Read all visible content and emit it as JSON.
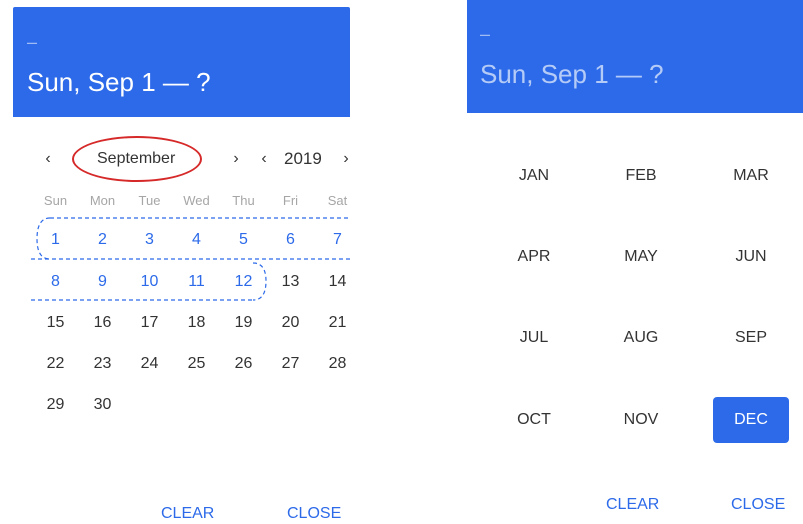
{
  "left": {
    "header": {
      "dash": "–",
      "title": "Sun, Sep 1 — ?"
    },
    "nav": {
      "prev_month": "‹",
      "month": "September",
      "next_month": "›",
      "prev_year": "‹",
      "year": "2019",
      "next_year": "›"
    },
    "weekdays": [
      "Sun",
      "Mon",
      "Tue",
      "Wed",
      "Thu",
      "Fri",
      "Sat"
    ],
    "weeks": [
      [
        "1",
        "2",
        "3",
        "4",
        "5",
        "6",
        "7"
      ],
      [
        "8",
        "9",
        "10",
        "11",
        "12",
        "13",
        "14"
      ],
      [
        "15",
        "16",
        "17",
        "18",
        "19",
        "20",
        "21"
      ],
      [
        "22",
        "23",
        "24",
        "25",
        "26",
        "27",
        "28"
      ],
      [
        "29",
        "30",
        "",
        "",
        "",
        "",
        ""
      ]
    ],
    "highlighted_days": [
      "1",
      "2",
      "3",
      "4",
      "5",
      "6",
      "7",
      "8",
      "9",
      "10",
      "11",
      "12"
    ],
    "buttons": {
      "clear": "CLEAR",
      "close": "CLOSE"
    }
  },
  "right": {
    "header": {
      "dash": "–",
      "title": "Sun, Sep 1 — ?"
    },
    "months": [
      [
        "JAN",
        "FEB",
        "MAR"
      ],
      [
        "APR",
        "MAY",
        "JUN"
      ],
      [
        "JUL",
        "AUG",
        "SEP"
      ],
      [
        "OCT",
        "NOV",
        "DEC"
      ]
    ],
    "selected_month": "DEC",
    "buttons": {
      "clear": "CLEAR",
      "close": "CLOSE"
    }
  },
  "colors": {
    "accent": "#2c6ae9",
    "annotation": "#d62929",
    "text": "#333333",
    "muted": "#a6a6a6"
  }
}
